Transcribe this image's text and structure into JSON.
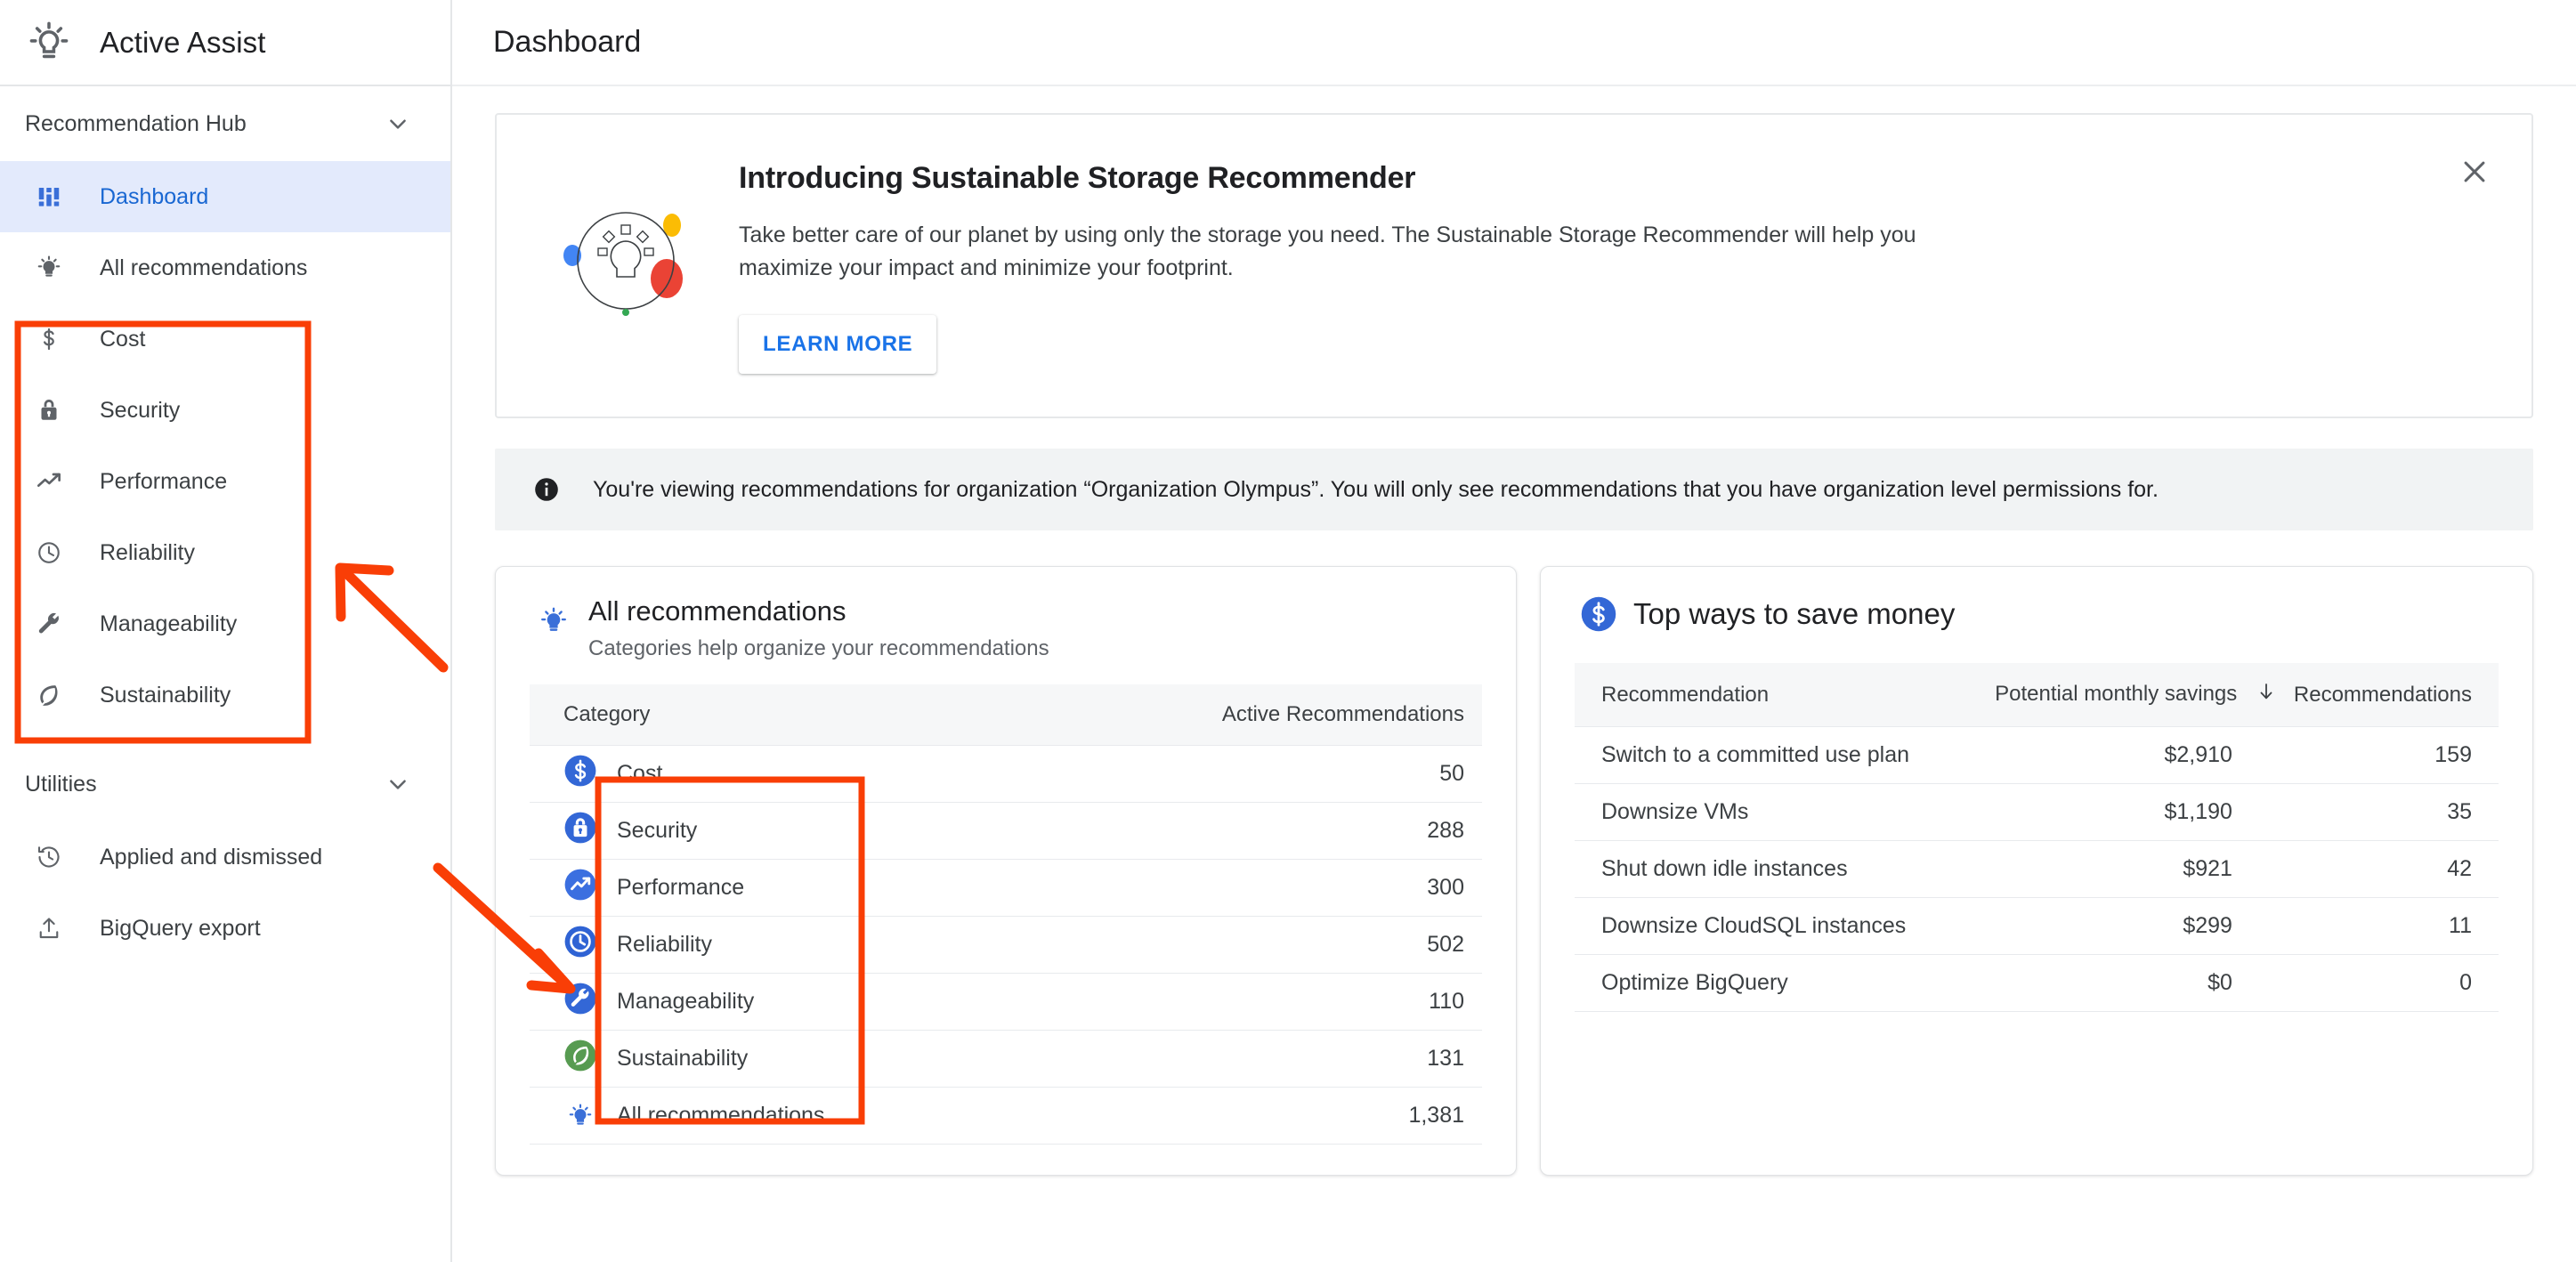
{
  "sidebar": {
    "brand": "Active Assist",
    "brand_icon": "lightbulb-idea-icon",
    "sections": [
      {
        "label": "Recommendation Hub",
        "expanded": true
      },
      {
        "label": "Utilities",
        "expanded": true
      }
    ],
    "hub_items": [
      {
        "label": "Dashboard",
        "icon": "dashboard-icon",
        "active": true
      },
      {
        "label": "All recommendations",
        "icon": "lightbulb-icon",
        "active": false
      },
      {
        "label": "Cost",
        "icon": "dollar-icon",
        "active": false
      },
      {
        "label": "Security",
        "icon": "lock-icon",
        "active": false
      },
      {
        "label": "Performance",
        "icon": "trending-up-icon",
        "active": false
      },
      {
        "label": "Reliability",
        "icon": "clock-icon",
        "active": false
      },
      {
        "label": "Manageability",
        "icon": "wrench-icon",
        "active": false
      },
      {
        "label": "Sustainability",
        "icon": "leaf-icon",
        "active": false
      }
    ],
    "utility_items": [
      {
        "label": "Applied and dismissed",
        "icon": "history-icon"
      },
      {
        "label": "BigQuery export",
        "icon": "upload-icon"
      }
    ]
  },
  "header": {
    "title": "Dashboard"
  },
  "promo": {
    "title": "Introducing Sustainable Storage Recommender",
    "body": "Take better care of our planet by using only the storage you need. The Sustainable Storage Recommender will help you maximize your impact and minimize your footprint.",
    "button_label": "LEARN MORE",
    "close_icon": "close-icon",
    "illustration_icon": "lightbulb-circle-illustration"
  },
  "info_notice": {
    "icon": "info-icon",
    "text": "You're viewing recommendations for organization “Organization Olympus”. You will only see recommendations that you have organization level permissions for."
  },
  "all_recommendations_card": {
    "icon": "lightbulb-icon",
    "title": "All recommendations",
    "subtitle": "Categories help organize your recommendations",
    "columns": [
      "Category",
      "Active Recommendations"
    ],
    "rows": [
      {
        "category": "Cost",
        "icon": "dollar-circle-icon",
        "color": "#3367d6",
        "count": "50"
      },
      {
        "category": "Security",
        "icon": "lock-circle-icon",
        "color": "#3367d6",
        "count": "288"
      },
      {
        "category": "Performance",
        "icon": "trending-up-circle-icon",
        "color": "#3b6fe0",
        "count": "300"
      },
      {
        "category": "Reliability",
        "icon": "clock-circle-icon",
        "color": "#2f63d4",
        "count": "502"
      },
      {
        "category": "Manageability",
        "icon": "wrench-circle-icon",
        "color": "#3367d6",
        "count": "110"
      },
      {
        "category": "Sustainability",
        "icon": "leaf-circle-icon",
        "color": "#579b51",
        "count": "131"
      }
    ],
    "total_row": {
      "category": "All recommendations",
      "icon": "lightbulb-icon",
      "count": "1,381"
    }
  },
  "savings_card": {
    "icon": "dollar-circle-icon",
    "title": "Top ways to save money",
    "columns": [
      "Recommendation",
      "Potential monthly savings",
      "Recommendations"
    ],
    "sort_indicator": "sort-descending-arrow",
    "rows": [
      {
        "name": "Switch to a committed use plan",
        "savings": "$2,910",
        "count": "159"
      },
      {
        "name": "Downsize VMs",
        "savings": "$1,190",
        "count": "35"
      },
      {
        "name": "Shut down idle instances",
        "savings": "$921",
        "count": "42"
      },
      {
        "name": "Downsize CloudSQL instances",
        "savings": "$299",
        "count": "11"
      },
      {
        "name": "Optimize BigQuery",
        "savings": "$0",
        "count": "0"
      }
    ]
  },
  "annotations": {
    "color": "#f93e06",
    "boxes": [
      {
        "name": "sidebar-categories-highlight"
      },
      {
        "name": "table-categories-highlight"
      }
    ],
    "arrows": [
      {
        "name": "arrow-to-sidebar-categories"
      },
      {
        "name": "arrow-to-table-categories"
      }
    ]
  }
}
